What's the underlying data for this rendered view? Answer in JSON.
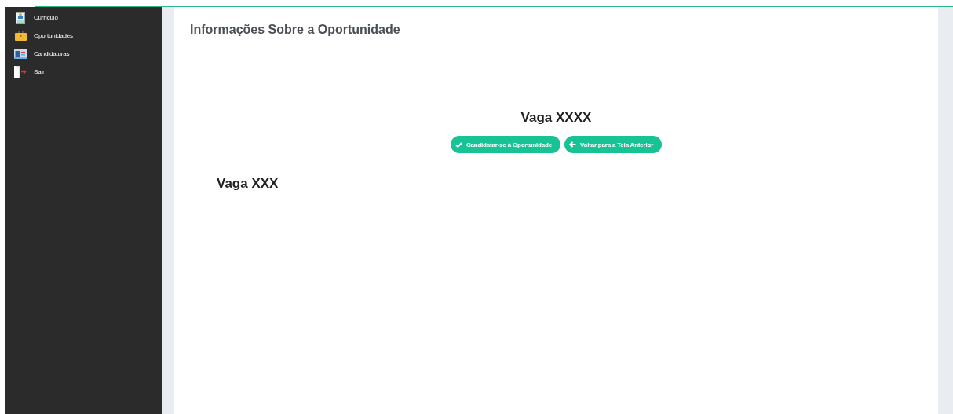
{
  "sidebar": {
    "items": [
      {
        "label": "Currículo",
        "kind": "document"
      },
      {
        "label": "Oportunidades",
        "kind": "briefcase"
      },
      {
        "label": "Candidaturas",
        "kind": "card"
      },
      {
        "label": "Sair",
        "kind": "exit"
      }
    ]
  },
  "page": {
    "title": "Informações Sobre a Oportunidade",
    "heading": "Vaga XXXX",
    "buttons": [
      {
        "label": "Candidatar-se à Oportunidade",
        "kind": "check"
      },
      {
        "label": "Voltar para a Tela Anterior",
        "kind": "back"
      }
    ],
    "subheading": "Vaga XXX"
  }
}
